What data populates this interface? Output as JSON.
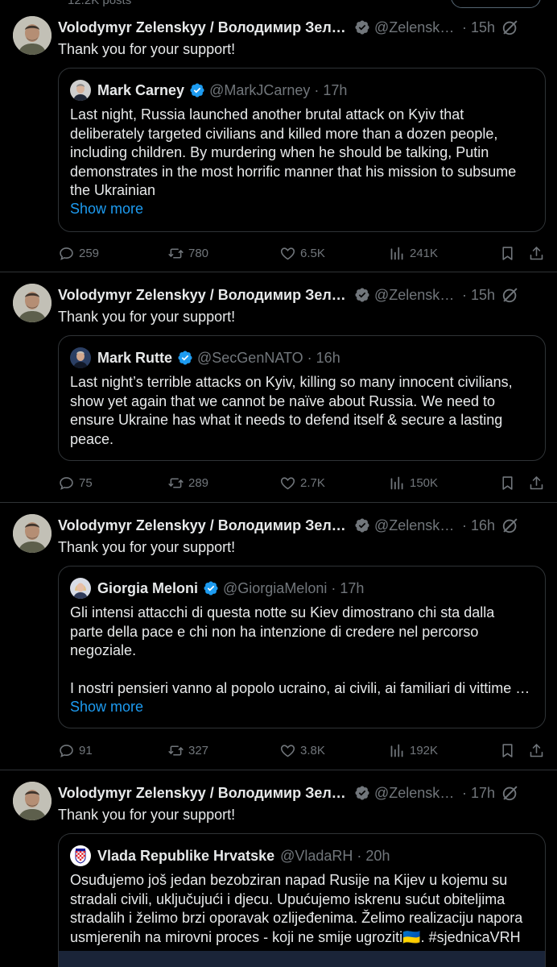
{
  "profile_header": {
    "posts_count": "12.2K posts"
  },
  "colors": {
    "accent": "#1d9bf0",
    "verified": "#71767b",
    "muted": "#71767b",
    "border": "#2f3336"
  },
  "tweets": [
    {
      "author": "Volodymyr Zelenskyy / Володимир Зеле…",
      "handle": "@Zelensky…",
      "time": "15h",
      "text": "Thank you for your support!",
      "quote": {
        "author": "Mark Carney",
        "handle": "@MarkJCarney",
        "time": "17h",
        "lines": [
          "Last night, Russia launched another brutal attack on Kyiv that",
          "deliberately targeted civilians and killed more than a dozen people,",
          "including children. By murdering when he should be talking, Putin",
          "demonstrates in the most horrific manner that his mission to subsume",
          "the Ukrainian"
        ],
        "show_more": "Show more"
      },
      "stats": {
        "replies": "259",
        "reposts": "780",
        "likes": "6.5K",
        "views": "241K"
      }
    },
    {
      "author": "Volodymyr Zelenskyy / Володимир Зеле…",
      "handle": "@Zelensky…",
      "time": "15h",
      "text": "Thank you for your support!",
      "quote": {
        "author": "Mark Rutte",
        "handle": "@SecGenNATO",
        "time": "16h",
        "lines": [
          "Last night’s terrible attacks on Kyiv, killing so many innocent civilians,",
          "show yet again that we cannot be naïve about Russia. We need to",
          "ensure Ukraine has what it needs to defend itself & secure a lasting",
          "peace."
        ]
      },
      "stats": {
        "replies": "75",
        "reposts": "289",
        "likes": "2.7K",
        "views": "150K"
      }
    },
    {
      "author": "Volodymyr Zelenskyy / Володимир Зеле…",
      "handle": "@Zelensky…",
      "time": "16h",
      "text": "Thank you for your support!",
      "quote": {
        "author": "Giorgia Meloni",
        "handle": "@GiorgiaMeloni",
        "time": "17h",
        "lines": [
          "Gli intensi attacchi di questa notte su Kiev dimostrano chi sta dalla",
          "parte della pace e chi non ha intenzione di credere nel percorso",
          "negoziale.",
          "",
          "I nostri pensieri vanno al popolo ucraino, ai civili, ai familiari di vittime …"
        ],
        "show_more": "Show more"
      },
      "stats": {
        "replies": "91",
        "reposts": "327",
        "likes": "3.8K",
        "views": "192K"
      }
    },
    {
      "author": "Volodymyr Zelenskyy / Володимир Зеле…",
      "handle": "@Zelensky…",
      "time": "17h",
      "text": "Thank you for your support!",
      "quote": {
        "author": "Vlada Republike Hrvatske",
        "handle": "@VladaRH",
        "time": "20h",
        "lines": [
          "Osuđujemo još jedan bezobziran napad Rusije na Kijev u kojemu su",
          "stradali civili, uključujući i djecu. Upućujemo iskrenu sućut obiteljima",
          "stradalih i želimo brzi oporavak ozlijeđenima. Želimo realizaciju napora",
          "usmjerenih na mirovni proces - koji ne smije ugroziti🇺🇦. #sjednicaVRH"
        ]
      }
    }
  ]
}
